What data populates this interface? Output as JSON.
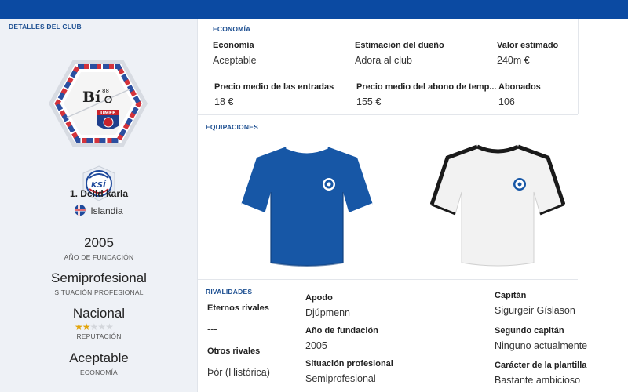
{
  "sidebar": {
    "title": "DETALLES DEL CLUB",
    "crest_text": "Bí",
    "crest_superscript": "88",
    "crest_badge_text": "UMFB",
    "league_logo_text": "KSÍ",
    "league": "1. Deild karla",
    "country": "Islandia",
    "founded": "2005",
    "founded_label": "AÑO DE FUNDACIÓN",
    "status": "Semiprofesional",
    "status_label": "SITUACIÓN PROFESIONAL",
    "reputation": "Nacional",
    "reputation_stars": 1.5,
    "reputation_max": 5,
    "reputation_label": "REPUTACIÓN",
    "economy": "Aceptable",
    "economy_label": "ECONOMÍA"
  },
  "economy": {
    "title": "ECONOMÍA",
    "economy_label": "Economía",
    "economy_value": "Aceptable",
    "owner_label": "Estimación del dueño",
    "owner_value": "Adora al club",
    "value_label": "Valor estimado",
    "value_value": "240m €",
    "ticket_label": "Precio medio de las entradas",
    "ticket_value": "18 €",
    "season_label": "Precio medio del abono de temp...",
    "season_value": "155 €",
    "subscribers_label": "Abonados",
    "subscribers_value": "106"
  },
  "kits": {
    "title": "EQUIPACIONES",
    "home_color": "#1757a6",
    "away_color": "#f2f2f2"
  },
  "rivals": {
    "title": "RIVALIDADES",
    "eternal_label": "Eternos rivales",
    "eternal_value": "---",
    "other_label": "Otros rivales",
    "other_value": "Þór (Histórica)"
  },
  "details": {
    "nickname_label": "Apodo",
    "nickname_value": "Djúpmenn",
    "founded_label": "Año de fundación",
    "founded_value": "2005",
    "status_label": "Situación profesional",
    "status_value": "Semiprofesional"
  },
  "captains": {
    "captain_label": "Capitán",
    "captain_value": "Sigurgeir Gíslason",
    "vice_label": "Segundo capitán",
    "vice_value": "Ninguno actualmente",
    "character_label": "Carácter de la plantilla",
    "character_value": "Bastante ambicioso"
  },
  "colors": {
    "header_blue": "#0b4aa2",
    "section_blue": "#1d4f91",
    "star": "#e2a40a"
  }
}
